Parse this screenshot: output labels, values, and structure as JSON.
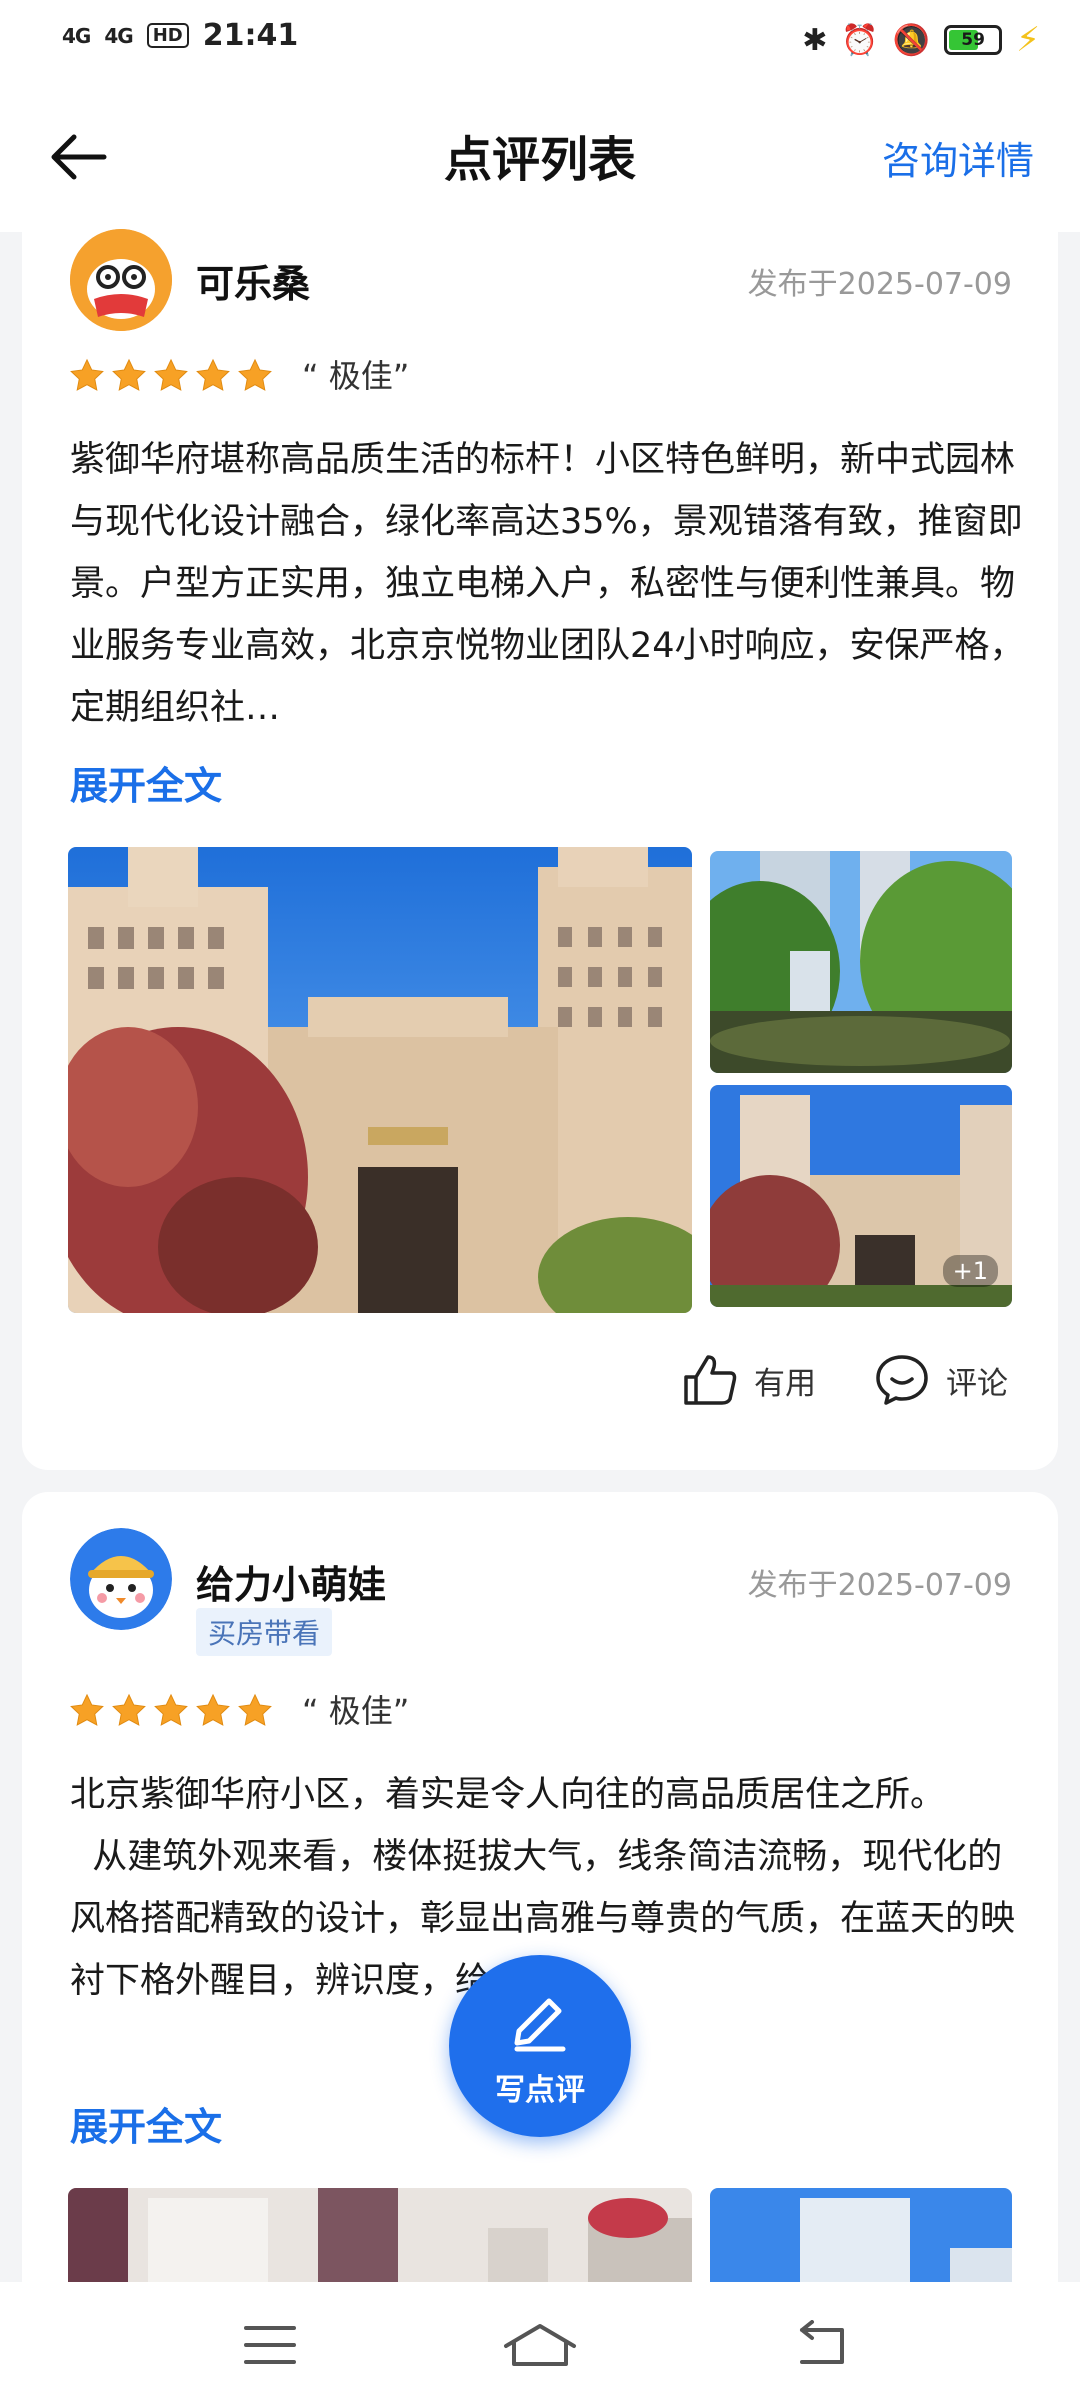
{
  "status_bar": {
    "time": "21:41",
    "signal1": "4G",
    "signal2": "4G",
    "hd": "HD",
    "battery": "59"
  },
  "nav": {
    "title": "点评列表",
    "right_link": "咨询详情"
  },
  "reviews": [
    {
      "user": "可乐桑",
      "date": "发布于2025-07-09",
      "rating_text": "“ 极佳”",
      "text": "紫御华府堪称高品质生活的标杆！小区特色鲜明，新中式园林与现代化设计融合，绿化率高达35%，景观错落有致，推窗即景。户型方正实用，独立电梯入户，私密性与便利性兼具。物业服务专业高效，北京京悦物业团队24小时响应，安保严格，定期组织社…",
      "expand": "展开全文",
      "photo_more": "+1",
      "useful": "有用",
      "comment": "评论"
    },
    {
      "user": "给力小萌娃",
      "tag": "买房带看",
      "date": "发布于2025-07-09",
      "rating_text": "“ 极佳”",
      "text": "北京紫御华府小区，着实是令人向往的高品质居住之所。\n  从建筑外观来看，楼体挺拔大气，线条简洁流畅，现代化的风格搭配精致的设计，彰显出高雅与尊贵的气质，在蓝天的映衬下格外醒目，辨识度，给…",
      "expand": "展开全文"
    }
  ],
  "fab": {
    "label": "写点评"
  },
  "colors": {
    "accent": "#1a6fe8",
    "star": "#f7a125",
    "fab": "#1f6fec"
  },
  "icons": [
    "back-arrow-icon",
    "star-icon",
    "thumbs-up-icon",
    "comment-icon",
    "pen-icon",
    "menu-icon",
    "home-icon",
    "return-icon"
  ]
}
